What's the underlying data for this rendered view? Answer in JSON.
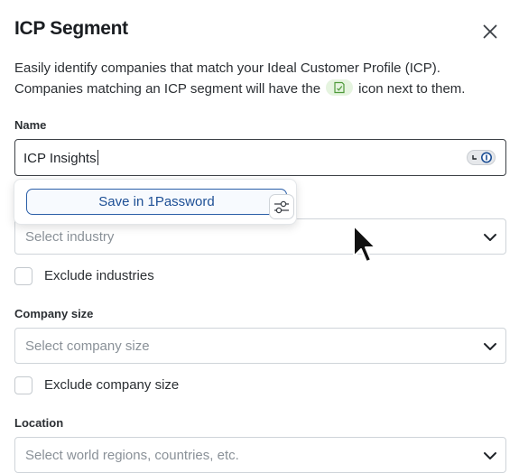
{
  "dialog": {
    "title": "ICP Segment",
    "description_line1": "Easily identify companies that match your Ideal Customer Profile (ICP).",
    "description_line2_pre": "Companies matching an ICP segment will have the",
    "description_line2_post": "icon next to them."
  },
  "name_field": {
    "label": "Name",
    "value": "ICP Insights"
  },
  "password_manager": {
    "save_label": "Save in 1Password"
  },
  "industry_field": {
    "placeholder": "Select industry",
    "exclude_label": "Exclude industries"
  },
  "company_size_field": {
    "label": "Company size",
    "placeholder": "Select company size",
    "exclude_label": "Exclude company size"
  },
  "location_field": {
    "label": "Location",
    "placeholder": "Select world regions, countries, etc."
  },
  "colors": {
    "accent_blue": "#1d4f95",
    "badge_green": "#e5f4df"
  }
}
